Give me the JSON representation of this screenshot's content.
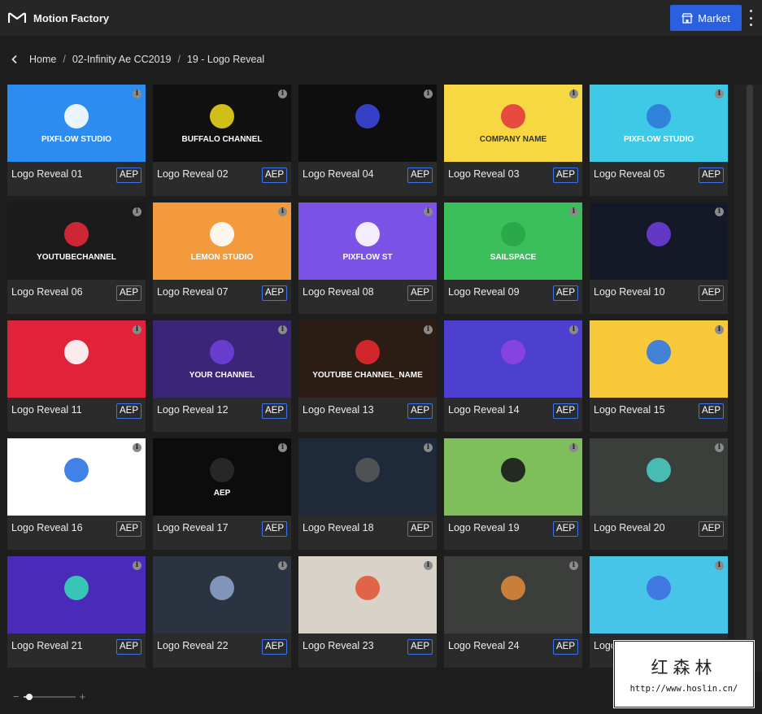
{
  "app": {
    "title": "Motion Factory"
  },
  "header": {
    "market_label": "Market"
  },
  "breadcrumb": [
    "Home",
    "02-Infinity Ae CC2019",
    "19 - Logo Reveal"
  ],
  "zoom": {
    "level": 0.08
  },
  "watermark": {
    "cn": "红森林",
    "url": "http://www.hoslin.cn/"
  },
  "items": [
    {
      "title": "Logo Reveal 01",
      "badge": "AEP",
      "thumb": {
        "bg": "#2d8cf0",
        "text": "PIXFLOW STUDIO",
        "accent": "#ffffff"
      }
    },
    {
      "title": "Logo Reveal 02",
      "badge": "AEP",
      "thumb": {
        "bg": "#111111",
        "text": "BUFFALO CHANNEL",
        "accent": "#e8d21b"
      }
    },
    {
      "title": "Logo Reveal 04",
      "badge": "AEP",
      "thumb": {
        "bg": "#0e0e0e",
        "text": "",
        "accent": "#3b46d8"
      }
    },
    {
      "title": "Logo Reveal 03",
      "badge": "AEP",
      "thumb": {
        "bg": "#f7d843",
        "text": "COMPANY NAME",
        "accent": "#e23d3d"
      }
    },
    {
      "title": "Logo Reveal 05",
      "badge": "AEP",
      "thumb": {
        "bg": "#3ec9e6",
        "text": "PIXFLOW STUDIO",
        "accent": "#2f7ad9"
      }
    },
    {
      "title": "Logo Reveal 06",
      "badge": "AEP",
      "thumb": {
        "bg": "#1b1b1b",
        "text": "YOUTUBECHANNEL",
        "accent": "#e2283a"
      }
    },
    {
      "title": "Logo Reveal 07",
      "badge": "AEP",
      "thumb": {
        "bg": "#f39a3c",
        "text": "LEMON      STUDIO",
        "accent": "#ffffff"
      }
    },
    {
      "title": "Logo Reveal 08",
      "badge": "AEP",
      "thumb": {
        "bg": "#7a52e6",
        "text": "PIXFLOW ST",
        "accent": "#ffffff"
      }
    },
    {
      "title": "Logo Reveal 09",
      "badge": "AEP",
      "thumb": {
        "bg": "#3bbf5a",
        "text": "SAILSPACE",
        "accent": "#2aa548"
      }
    },
    {
      "title": "Logo Reveal 10",
      "badge": "AEP",
      "thumb": {
        "bg": "#151827",
        "text": "",
        "accent": "#6a3cd6"
      }
    },
    {
      "title": "Logo Reveal 11",
      "badge": "AEP",
      "thumb": {
        "bg": "#e1223b",
        "text": "",
        "accent": "#ffffff"
      }
    },
    {
      "title": "Logo Reveal 12",
      "badge": "AEP",
      "thumb": {
        "bg": "#3b2577",
        "text": "YOUR CHANNEL",
        "accent": "#6e3fd6"
      }
    },
    {
      "title": "Logo Reveal 13",
      "badge": "AEP",
      "thumb": {
        "bg": "#2b1d14",
        "text": "YOUTUBE CHANNEL_NAME",
        "accent": "#e0282e"
      }
    },
    {
      "title": "Logo Reveal 14",
      "badge": "AEP",
      "thumb": {
        "bg": "#4d3fd0",
        "text": "",
        "accent": "#8e44e0"
      }
    },
    {
      "title": "Logo Reveal 15",
      "badge": "AEP",
      "thumb": {
        "bg": "#f7c93a",
        "text": "",
        "accent": "#2f7ae6"
      }
    },
    {
      "title": "Logo Reveal 16",
      "badge": "AEP",
      "thumb": {
        "bg": "#ffffff",
        "text": "",
        "accent": "#2c74e6"
      }
    },
    {
      "title": "Logo Reveal 17",
      "badge": "AEP",
      "thumb": {
        "bg": "#0c0c0c",
        "text": "AEP",
        "accent": "#2a2a2a"
      }
    },
    {
      "title": "Logo Reveal 18",
      "badge": "AEP",
      "thumb": {
        "bg": "#1e2a3a",
        "text": "",
        "accent": "#555555"
      }
    },
    {
      "title": "Logo Reveal 19",
      "badge": "AEP",
      "thumb": {
        "bg": "#7fbf5b",
        "text": "",
        "accent": "#1a1a1a"
      }
    },
    {
      "title": "Logo Reveal 20",
      "badge": "AEP",
      "thumb": {
        "bg": "#3a3f3b",
        "text": "",
        "accent": "#4ac9c0"
      }
    },
    {
      "title": "Logo Reveal 21",
      "badge": "AEP",
      "thumb": {
        "bg": "#4a2ab8",
        "text": "",
        "accent": "#37d6b5"
      }
    },
    {
      "title": "Logo Reveal 22",
      "badge": "AEP",
      "thumb": {
        "bg": "#2c3340",
        "text": "",
        "accent": "#8aa0c8"
      }
    },
    {
      "title": "Logo Reveal 23",
      "badge": "AEP",
      "thumb": {
        "bg": "#d9d2c8",
        "text": "",
        "accent": "#e0583a"
      }
    },
    {
      "title": "Logo Reveal 24",
      "badge": "AEP",
      "thumb": {
        "bg": "#3b3e3a",
        "text": "",
        "accent": "#d9863a"
      }
    },
    {
      "title": "Logo Reveal 25",
      "badge": "AEP",
      "thumb": {
        "bg": "#47c5e8",
        "text": "",
        "accent": "#3f6fe0"
      }
    }
  ]
}
